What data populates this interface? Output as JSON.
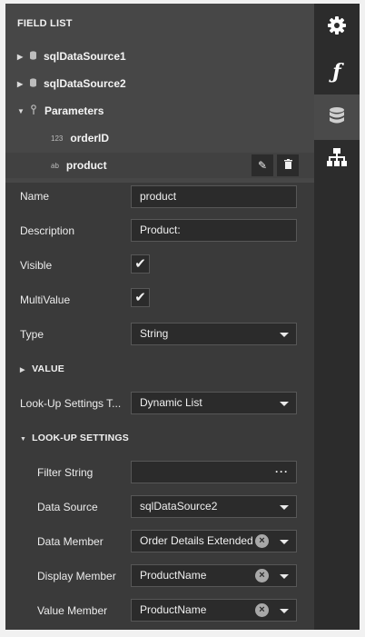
{
  "field_list": {
    "header": "FIELD LIST",
    "nodes": [
      {
        "label": "sqlDataSource1",
        "icon": "database-icon"
      },
      {
        "label": "sqlDataSource2",
        "icon": "database-icon"
      },
      {
        "label": "Parameters",
        "icon": "parameters-icon"
      }
    ],
    "params": [
      {
        "label": "orderID",
        "type_glyph": "123"
      },
      {
        "label": "product",
        "type_glyph": "ab"
      }
    ]
  },
  "props": {
    "name": {
      "label": "Name",
      "value": "product"
    },
    "description": {
      "label": "Description",
      "value": "Product:"
    },
    "visible": {
      "label": "Visible",
      "checked": true
    },
    "multivalue": {
      "label": "MultiValue",
      "checked": true
    },
    "type": {
      "label": "Type",
      "value": "String"
    },
    "value_section": "VALUE",
    "lookup_type": {
      "label": "Look-Up Settings T...",
      "value": "Dynamic List"
    },
    "lookup_section": "LOOK-UP SETTINGS",
    "filter_string": {
      "label": "Filter String",
      "value": ""
    },
    "data_source": {
      "label": "Data Source",
      "value": "sqlDataSource2"
    },
    "data_member": {
      "label": "Data Member",
      "value": "Order Details Extended"
    },
    "display_member": {
      "label": "Display Member",
      "value": "ProductName"
    },
    "value_member": {
      "label": "Value Member",
      "value": "ProductName"
    }
  },
  "sidebar": {
    "buttons": [
      "gear-icon",
      "function-icon",
      "database-icon",
      "hierarchy-icon"
    ],
    "active": "database-icon"
  }
}
